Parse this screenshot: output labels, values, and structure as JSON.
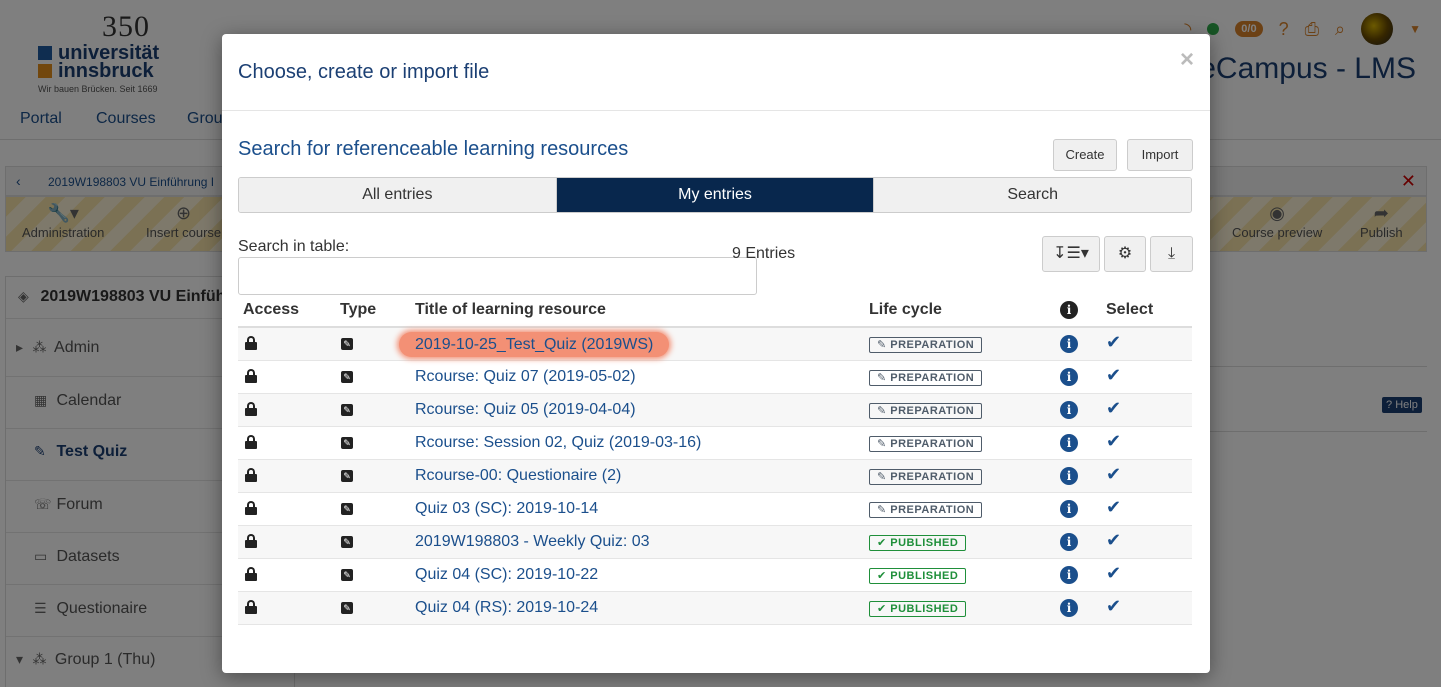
{
  "logo": {
    "year": "350",
    "name_line1": "universität",
    "name_line2": "innsbruck",
    "tagline": "Wir bauen Brücken. Seit 1669"
  },
  "header": {
    "brand": "eCampus - LMS",
    "notifications_badge": "0/0"
  },
  "nav": {
    "items": [
      "Portal",
      "Courses",
      "Grou"
    ]
  },
  "breadcrumb": {
    "text": "2019W198803 VU Einführung I"
  },
  "toolbar": {
    "administration": "Administration",
    "insert": "Insert course",
    "preview": "Course preview",
    "publish": "Publish"
  },
  "sidebar": {
    "course": "2019W198803 VU Einfüh",
    "items": [
      {
        "label": "Admin"
      },
      {
        "label": "Calendar"
      },
      {
        "label": "Test Quiz"
      },
      {
        "label": "Forum"
      },
      {
        "label": "Datasets"
      },
      {
        "label": "Questionaire"
      },
      {
        "label": "Group 1 (Thu)"
      }
    ]
  },
  "help": "Help",
  "modal": {
    "title": "Choose, create or import file",
    "close": "×",
    "section_title": "Search for referenceable learning resources",
    "create_label": "Create",
    "import_label": "Import",
    "tabs": [
      "All entries",
      "My entries",
      "Search"
    ],
    "search_label": "Search in table:",
    "search_value": "",
    "entries_count": "9 Entries",
    "columns": {
      "access": "Access",
      "type": "Type",
      "title": "Title of learning resource",
      "lifecycle": "Life cycle",
      "select": "Select"
    },
    "rows": [
      {
        "title": "2019-10-25_Test_Quiz (2019WS)",
        "lifecycle": "PREPARATION"
      },
      {
        "title": "Rcourse: Quiz 07 (2019-05-02)",
        "lifecycle": "PREPARATION"
      },
      {
        "title": "Rcourse: Quiz 05 (2019-04-04)",
        "lifecycle": "PREPARATION"
      },
      {
        "title": "Rcourse: Session 02, Quiz (2019-03-16)",
        "lifecycle": "PREPARATION"
      },
      {
        "title": "Rcourse-00: Questionaire (2)",
        "lifecycle": "PREPARATION"
      },
      {
        "title": "Quiz 03 (SC): 2019-10-14",
        "lifecycle": "PREPARATION"
      },
      {
        "title": "2019W198803 - Weekly Quiz: 03",
        "lifecycle": "PUBLISHED"
      },
      {
        "title": "Quiz 04 (SC): 2019-10-22",
        "lifecycle": "PUBLISHED"
      },
      {
        "title": "Quiz 04 (RS): 2019-10-24",
        "lifecycle": "PUBLISHED"
      }
    ]
  },
  "colors": {
    "accent": "#1b4f8c",
    "active_tab": "#08274d",
    "highlight": "#f39075",
    "published": "#1f8f3a"
  }
}
